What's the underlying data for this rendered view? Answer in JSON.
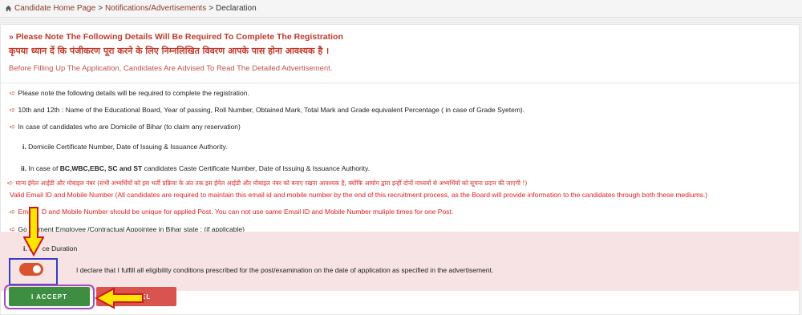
{
  "breadcrumb": {
    "home": "Candidate Home Page",
    "notifications": "Notifications/Advertisements",
    "current": "Declaration",
    "separator": ">"
  },
  "notice": {
    "title": "» Please Note The Following Details Will Be Required To Complete The Registration",
    "hindi": "कृपया ध्यान दें कि पंजीकरण पूरा करने के लिए निम्नलिखित विवरण आपके पास होना आवश्यक है ।",
    "advice": "Before Filling Up The Application, Candidates Are Advised To Read The Detailed Advertisement."
  },
  "items": {
    "i1": "Please note the following details will be required to complete the registration.",
    "i2": "10th and 12th : Name of the Educational Board, Year of passing, Roll Number, Obtained Mark, Total Mark and Grade equivalent Percentage ( in case of Grade Syetem).",
    "i3": "In case of candidates who are Domicile of Bihar (to claim any reservation)",
    "s1_num": "i.",
    "s1": "Domicile Certificate Number, Date of Issuing & Issuance Authority.",
    "s2_num": "ii.",
    "s2_pre": "In case of",
    "s2_bold": "BC,WBC,EBC, SC and ST",
    "s2_post": "candidates Caste Certificate Number, Date of Issuing & Issuance Authority.",
    "hindi_email": "मान्य ईमेल आईडी और मोबाइल नंबर (सभी अभ्यर्थियों को इस भर्ती प्रक्रिया के अंत तक इस ईमेल आईडी और मोबाइल नंबर को बनाए रखना आवश्यक है, क्योंकि आयोग द्वारा इन्हीं दोनों माध्यमों से अभ्यर्थियों को सूचना प्रदान की जाएगी !)",
    "email_en": "Valid Email ID and Mobile Number (All candidates are required to maintain this email id and mobile number by the end of this recruitment process, as the Board will provide information to the candidates through both these mediums.)",
    "unique_pre": "Ema",
    "unique_post": "D and Mobile Number should be unique for applied Post. You can not use same Email ID and Mobile Number muliple times for one Post.",
    "govt_pre": "Go",
    "govt_post": "ment Employee /Contractual Appointee in Bihar state : (if applicable)",
    "s3_num": "i.",
    "s3_pre": "S",
    "s3_post": "ce Duration"
  },
  "declaration": {
    "text": "I declare that I fulfill all eligibility conditions prescribed for the post/examination on the date of application as specified in the advertisement.",
    "toggle_on": true
  },
  "buttons": {
    "accept": "I ACCEPT",
    "cancel": "EL"
  },
  "colors": {
    "accent": "#c0392b",
    "accept": "#3e8e41",
    "cancel": "#d9534f",
    "highlight_box": "#3340c4",
    "highlight_oval": "#a54bc1",
    "annotation_arrow": "#ffe600"
  },
  "icons": {
    "home": "home-icon",
    "bullet": "hand-point-right-icon",
    "annotation": "yellow-arrow-icon"
  }
}
